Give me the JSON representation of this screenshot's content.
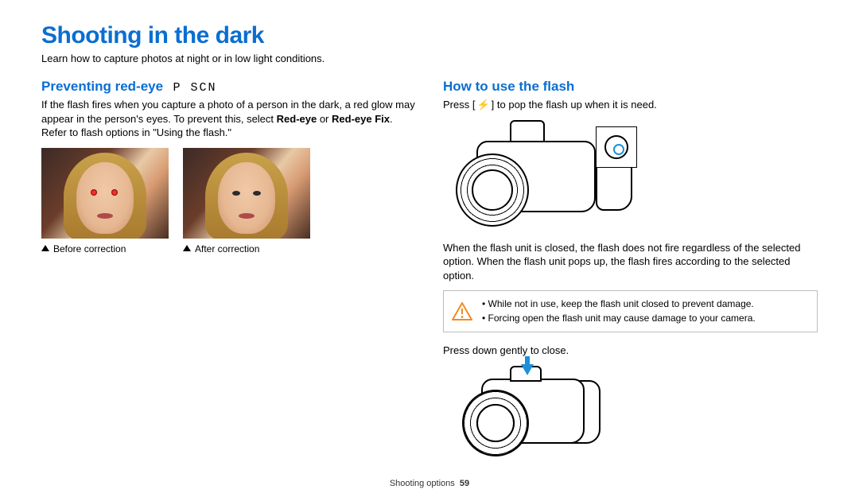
{
  "page": {
    "title": "Shooting in the dark",
    "subtitle": "Learn how to capture photos at night or in low light conditions."
  },
  "left": {
    "heading": "Preventing red-eye",
    "modes": "P SCN",
    "intro_pre": "If the flash fires when you capture a photo of a person in the dark, a red glow may appear in the person's eyes. To prevent this, select ",
    "bold1": "Red-eye",
    "intro_mid": " or ",
    "bold2": "Red-eye Fix",
    "intro_post": ". Refer to flash options in \"Using the flash.\"",
    "caption_before": "Before correction",
    "caption_after": "After correction"
  },
  "right": {
    "heading": "How to use the flash",
    "press_pre": "Press [",
    "flash_symbol": "⚡",
    "press_post": "] to pop the flash up when it is need.",
    "closed_flash_text": "When the flash unit is closed, the flash does not fire regardless of the selected option. When the flash unit pops up, the flash fires according to the selected option.",
    "warnings": [
      "While not in use, keep the flash unit closed to prevent damage.",
      "Forcing open the flash unit may cause damage to your camera."
    ],
    "close_instruction": "Press down gently to close."
  },
  "footer": {
    "section": "Shooting options",
    "page_number": "59"
  }
}
